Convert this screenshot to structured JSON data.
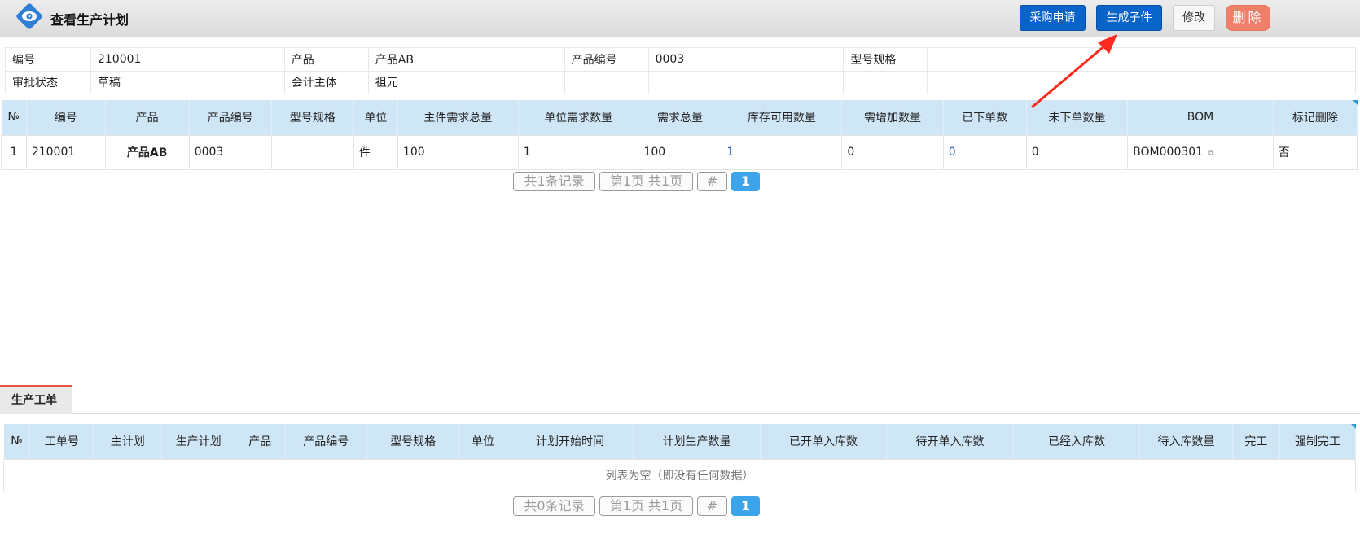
{
  "header": {
    "title": "查看生产计划",
    "buttons": {
      "purchase": "采购申请",
      "generate": "生成子件",
      "edit": "修改",
      "delete": "删除"
    }
  },
  "info": {
    "row1": [
      {
        "label": "编号",
        "value": "210001"
      },
      {
        "label": "产品",
        "value": "产品AB"
      },
      {
        "label": "产品编号",
        "value": "0003"
      },
      {
        "label": "型号规格",
        "value": ""
      }
    ],
    "row2": [
      {
        "label": "审批状态",
        "value": "草稿"
      },
      {
        "label": "会计主体",
        "value": "祖元"
      }
    ]
  },
  "plan_table": {
    "columns": [
      "№",
      "编号",
      "产品",
      "产品编号",
      "型号规格",
      "单位",
      "主件需求总量",
      "单位需求数量",
      "需求总量",
      "库存可用数量",
      "需增加数量",
      "已下单数",
      "未下单数量",
      "BOM",
      "标记删除"
    ],
    "rows": [
      [
        "1",
        "210001",
        "产品AB",
        "0003",
        "",
        "件",
        "100",
        "1",
        "100",
        "1",
        "0",
        "0",
        "0",
        "BOM000301",
        "否"
      ]
    ]
  },
  "pager1": {
    "records": "共1条记录",
    "pages": "第1页 共1页",
    "hash": "#",
    "current": "1"
  },
  "bottom": {
    "tab": "生产工单",
    "columns": [
      "№",
      "工单号",
      "主计划",
      "生产计划",
      "产品",
      "产品编号",
      "型号规格",
      "单位",
      "计划开始时间",
      "计划生产数量",
      "已开单入库数",
      "待开单入库数",
      "已经入库数",
      "待入库数量",
      "完工",
      "强制完工"
    ],
    "empty": "列表为空（即没有任何数据）"
  },
  "pager2": {
    "records": "共0条记录",
    "pages": "第1页 共1页",
    "hash": "#",
    "current": "1"
  },
  "colors": {
    "primary": "#0a63c9",
    "danger": "#f07f6a",
    "header_row": "#cfe6f7",
    "link": "#1f5fb6",
    "annotation": "#ff2a1f"
  }
}
